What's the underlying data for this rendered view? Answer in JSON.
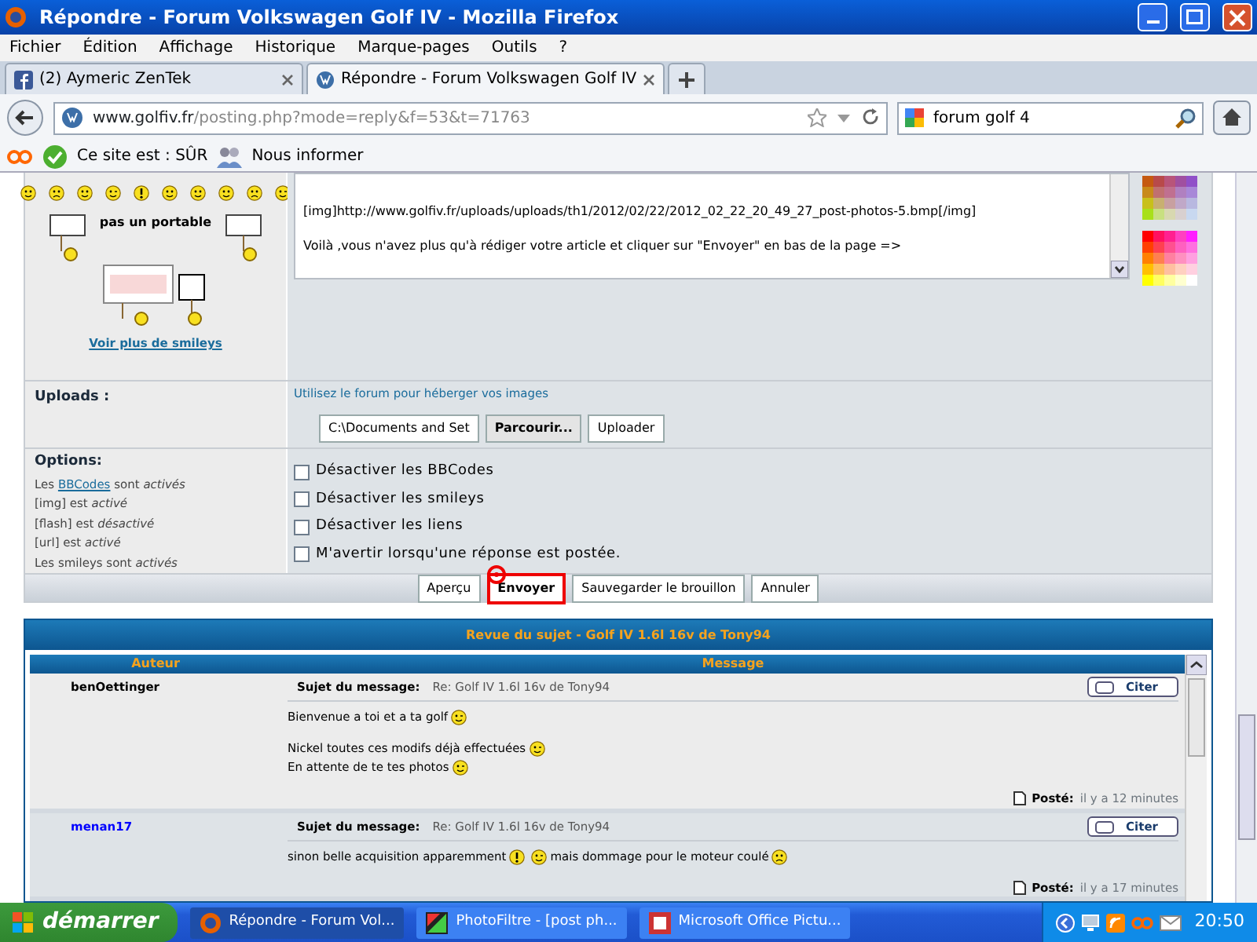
{
  "window": {
    "title": "Répondre - Forum Volkswagen Golf IV - Mozilla Firefox"
  },
  "menu": [
    "Fichier",
    "Édition",
    "Affichage",
    "Historique",
    "Marque-pages",
    "Outils",
    "?"
  ],
  "tabs": [
    {
      "label": "(2) Aymeric ZenTek",
      "kind": "facebook",
      "selected": false
    },
    {
      "label": "Répondre - Forum Volkswagen Golf IV",
      "kind": "vw",
      "selected": true
    }
  ],
  "address": {
    "host": "www.golfiv.fr",
    "path": "/posting.php?mode=reply&f=53&t=71763"
  },
  "search": {
    "value": "forum golf 4"
  },
  "addon_bar": {
    "status": "Ce site est : SÛR",
    "inform": "Nous informer"
  },
  "editor": {
    "caption": "pas un portable",
    "more_link": "Voir plus de smileys",
    "lines": [
      "[img]http://www.golfiv.fr/uploads/uploads/th1/2012/02/22/2012_02_22_20_49_27_post-photos-5.bmp[/img]",
      "Voilà ,vous n'avez plus qu'à rédiger votre article et cliquer sur \"Envoyer\" en bas de la page =>"
    ]
  },
  "uploads": {
    "label": "Uploads :",
    "hint": "Utilisez le forum pour héberger vos images",
    "file_value": "C:\\Documents and Set",
    "browse": "Parcourir...",
    "upload": "Uploader"
  },
  "options": {
    "label": "Options:",
    "notes": [
      {
        "prefix": "Les ",
        "link": "BBCodes",
        "text": " sont *activés*"
      },
      {
        "text": "[img] est *activé*"
      },
      {
        "text": "[flash] est *désactivé*"
      },
      {
        "text": "[url] est *activé*"
      },
      {
        "text": "Les smileys sont *activés*"
      }
    ],
    "checkboxes": [
      {
        "label": "Désactiver les BBCodes",
        "checked": false
      },
      {
        "label": "Désactiver les smileys",
        "checked": false
      },
      {
        "label": "Désactiver les liens",
        "checked": false
      },
      {
        "label": "M'avertir lorsqu'une réponse est postée.",
        "checked": false
      }
    ]
  },
  "buttons": [
    {
      "label": "Aperçu",
      "focused": false
    },
    {
      "label": "Envoyer",
      "focused": true
    },
    {
      "label": "Sauvegarder le brouillon",
      "focused": false
    },
    {
      "label": "Annuler",
      "focused": false
    }
  ],
  "review": {
    "title": "Revue du sujet - Golf IV 1.6l 16v de Tony94",
    "columns": [
      "Auteur",
      "Message"
    ],
    "posts": [
      {
        "author": "benOettinger",
        "color": "#000000",
        "subject_label": "Sujet du message:",
        "subject": "Re: Golf IV 1.6l 16v de Tony94",
        "quote": "Citer",
        "paragraphs": [
          [
            [
              {
                "kind": "text",
                "text": "Bienvenue a toi et a ta golf"
              },
              {
                "kind": "wink"
              }
            ]
          ],
          [
            [
              {
                "kind": "text",
                "text": "Nickel toutes ces modifs déjà effectuées"
              },
              {
                "kind": "wink"
              }
            ],
            [
              {
                "kind": "text",
                "text": "En attente de te tes photos"
              },
              {
                "kind": "wink"
              }
            ]
          ]
        ],
        "posted_label": "Posté:",
        "posted": "il y a 12 minutes"
      },
      {
        "author": "menan17",
        "color": "#0000ff",
        "subject_label": "Sujet du message:",
        "subject": "Re: Golf IV 1.6l 16v de Tony94",
        "quote": "Citer",
        "paragraphs": [
          [
            [
              {
                "kind": "text",
                "text": "sinon belle acquisition apparemment"
              },
              {
                "kind": "exclaim"
              },
              {
                "kind": "wink"
              },
              {
                "kind": "text",
                "text": "mais dommage pour le moteur coulé"
              },
              {
                "kind": "sad"
              }
            ]
          ]
        ],
        "posted_label": "Posté:",
        "posted": "il y a 17 minutes"
      }
    ]
  },
  "taskbar": {
    "start": "démarrer",
    "tasks": [
      {
        "label": "Répondre - Forum Vol...",
        "kind": "firefox",
        "selected": true
      },
      {
        "label": "PhotoFiltre - [post ph...",
        "kind": "photofiltre",
        "selected": false
      },
      {
        "label": "Microsoft Office Pictu...",
        "kind": "office",
        "selected": false
      }
    ],
    "clock": "20:50"
  }
}
